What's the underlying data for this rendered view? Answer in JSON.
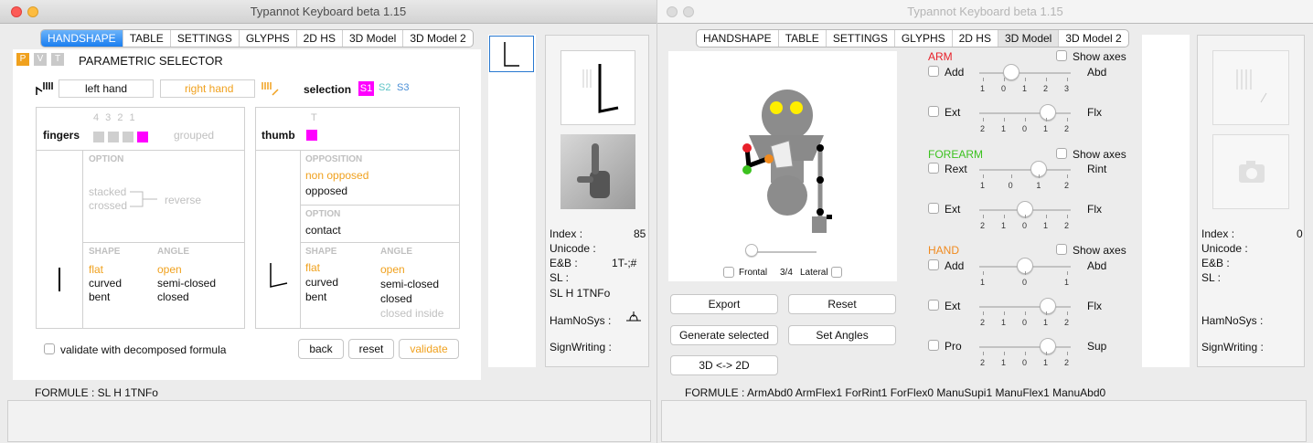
{
  "left": {
    "title": "Typannot Keyboard beta 1.15",
    "tabs": [
      "HANDSHAPE",
      "TABLE",
      "SETTINGS",
      "GLYPHS",
      "2D HS",
      "3D Model",
      "3D Model 2"
    ],
    "pvt": [
      "P",
      "V",
      "T"
    ],
    "header": "PARAMETRIC SELECTOR",
    "left_hand": "left hand",
    "right_hand": "right hand",
    "selection_label": "selection",
    "selections": [
      "S1",
      "S2",
      "S3"
    ],
    "finger_nums": "4 3 2 1",
    "fingers_label": "fingers",
    "grouped": "grouped",
    "thumb_t": "T",
    "thumb_label": "thumb",
    "option_header": "OPTION",
    "stacked": "stacked",
    "crossed": "crossed",
    "reverse": "reverse",
    "opposition_header": "OPPOSITION",
    "non_opposed": "non opposed",
    "opposed": "opposed",
    "option2_header": "OPTION",
    "contact": "contact",
    "shape_header": "SHAPE",
    "angle_header": "ANGLE",
    "shapes": [
      "flat",
      "curved",
      "bent"
    ],
    "angles": [
      "open",
      "semi-closed",
      "closed"
    ],
    "thumb_shapes": [
      "flat",
      "curved",
      "bent"
    ],
    "thumb_angles": [
      "open",
      "semi-closed",
      "closed",
      "closed inside"
    ],
    "validate_decomposed": "validate with decomposed formula",
    "back": "back",
    "reset": "reset",
    "validate": "validate",
    "formule": "FORMULE :  SL H 1TNFo",
    "info": {
      "index_label": "Index :",
      "index_val": "85",
      "unicode_label": "Unicode :",
      "eb_label": "E&B :",
      "eb_val": "1T-;#",
      "sl_label": "SL :",
      "sl_val": "SL H 1TNFo",
      "hamnosys_label": "HamNoSys :",
      "signwriting_label": "SignWriting :"
    }
  },
  "right": {
    "title": "Typannot Keyboard beta 1.15",
    "tabs": [
      "HANDSHAPE",
      "TABLE",
      "SETTINGS",
      "GLYPHS",
      "2D HS",
      "3D Model",
      "3D Model 2"
    ],
    "frontal": "Frontal",
    "ratio": "3/4",
    "lateral": "Lateral",
    "export": "Export",
    "reset": "Reset",
    "generate": "Generate selected",
    "set_angles": "Set Angles",
    "toggle": "3D <-> 2D",
    "arm": "ARM",
    "forearm": "FOREARM",
    "hand": "HAND",
    "show_axes": "Show axes",
    "sliders": [
      {
        "left": "Add",
        "right": "Abd",
        "ticks": [
          "1",
          "0",
          "1",
          "2",
          "3"
        ]
      },
      {
        "left": "Ext",
        "right": "Flx",
        "ticks": [
          "2",
          "1",
          "0",
          "1",
          "2"
        ]
      },
      {
        "left": "Rext",
        "right": "Rint",
        "ticks": [
          "1",
          "0",
          "1",
          "2"
        ]
      },
      {
        "left": "Ext",
        "right": "Flx",
        "ticks": [
          "2",
          "1",
          "0",
          "1",
          "2"
        ]
      },
      {
        "left": "Add",
        "right": "Abd",
        "ticks": [
          "1",
          "0",
          "1"
        ]
      },
      {
        "left": "Ext",
        "right": "Flx",
        "ticks": [
          "2",
          "1",
          "0",
          "1",
          "2"
        ]
      },
      {
        "left": "Pro",
        "right": "Sup",
        "ticks": [
          "2",
          "1",
          "0",
          "1",
          "2"
        ]
      }
    ],
    "formule": "FORMULE :  ArmAbd0 ArmFlex1 ForRint1 ForFlex0 ManuSupi1 ManuFlex1 ManuAbd0",
    "info": {
      "index_label": "Index :",
      "index_val": "0",
      "unicode_label": "Unicode :",
      "eb_label": "E&B :",
      "sl_label": "SL :",
      "hamnosys_label": "HamNoSys :",
      "signwriting_label": "SignWriting :"
    }
  },
  "colors": {
    "accent": "#1a7ef0",
    "magenta": "#ff00ff",
    "orange": "#f0a11e",
    "arm_red": "#e8202a",
    "forearm_green": "#3cc21f",
    "hand_orange": "#f08a1e"
  }
}
